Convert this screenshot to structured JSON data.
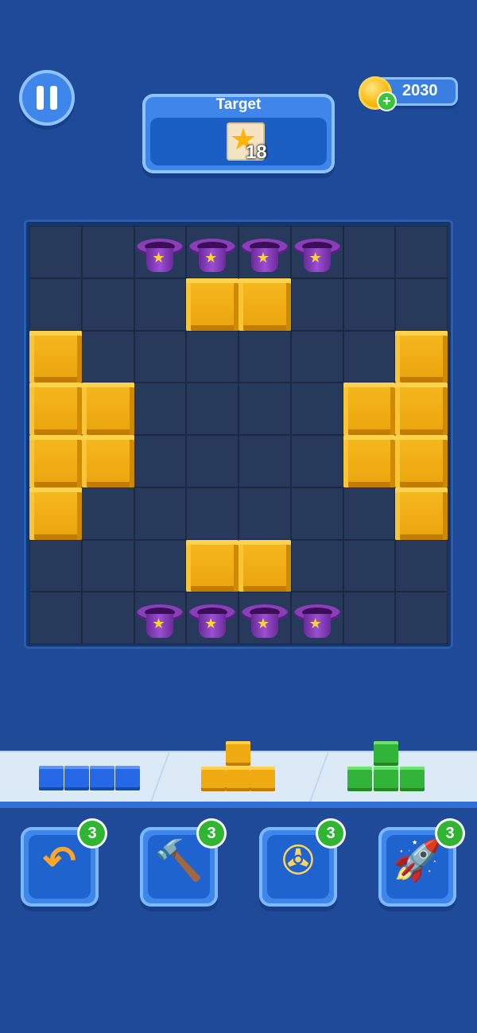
{
  "top_bar": {
    "coins": "2030",
    "coin_plus": "+"
  },
  "target": {
    "label": "Target",
    "icon": "star-tile-icon",
    "count": "18"
  },
  "board": {
    "rows": 8,
    "cols": 8,
    "cells": [
      "........",
      "........",
      "........",
      "........",
      "........",
      "........",
      "........",
      "........"
    ],
    "blocks": [
      [
        1,
        3
      ],
      [
        1,
        4
      ],
      [
        2,
        0
      ],
      [
        2,
        7
      ],
      [
        3,
        0
      ],
      [
        3,
        1
      ],
      [
        3,
        6
      ],
      [
        3,
        7
      ],
      [
        4,
        0
      ],
      [
        4,
        1
      ],
      [
        4,
        6
      ],
      [
        4,
        7
      ],
      [
        5,
        0
      ],
      [
        5,
        7
      ],
      [
        6,
        3
      ],
      [
        6,
        4
      ]
    ],
    "hats": [
      [
        0,
        2
      ],
      [
        0,
        3
      ],
      [
        0,
        4
      ],
      [
        0,
        5
      ],
      [
        7,
        2
      ],
      [
        7,
        3
      ],
      [
        7,
        4
      ],
      [
        7,
        5
      ]
    ],
    "colors": {
      "block": "#f0aa12",
      "cell": "#273a5b",
      "hat": "#8a3fb8"
    }
  },
  "tray": {
    "pieces": [
      {
        "name": "blue-line-piece",
        "color": "#2569e6"
      },
      {
        "name": "yellow-t-piece",
        "color": "#f0aa12"
      },
      {
        "name": "green-t-piece",
        "color": "#32b43a"
      }
    ]
  },
  "boosters": [
    {
      "name": "undo",
      "icon": "undo-icon",
      "count": "3"
    },
    {
      "name": "hammer",
      "icon": "hammer-icon",
      "count": "3"
    },
    {
      "name": "propeller",
      "icon": "propeller-icon",
      "count": "3"
    },
    {
      "name": "rocket",
      "icon": "rocket-icon",
      "count": "3"
    }
  ]
}
